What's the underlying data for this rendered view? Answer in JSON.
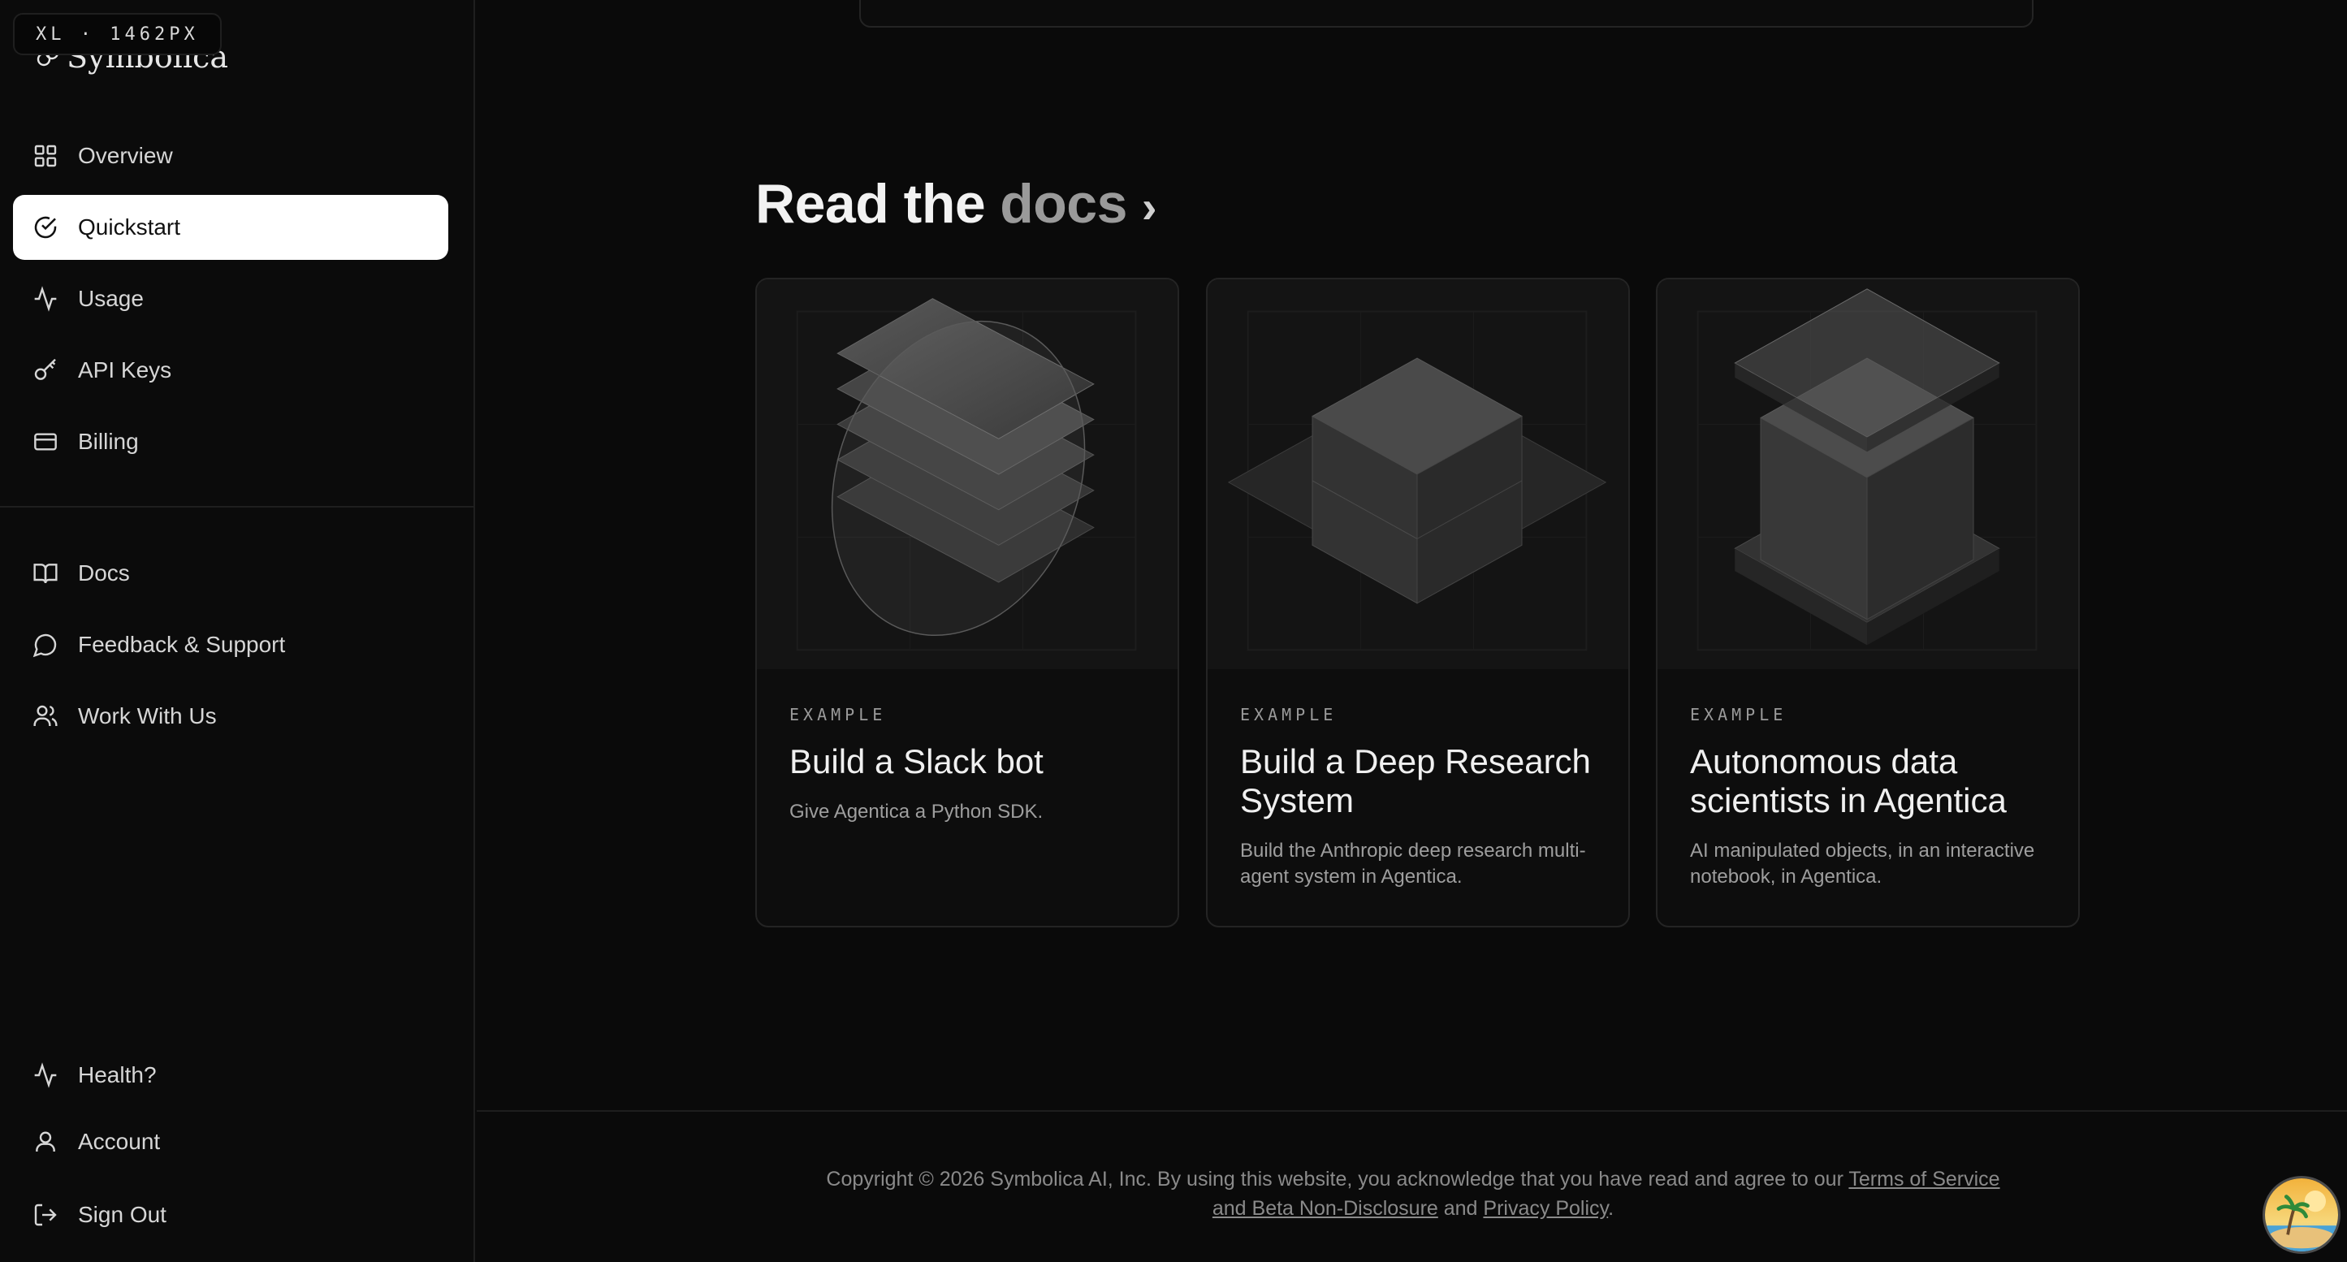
{
  "breakpoint_badge": "XL · 1462PX",
  "brand": {
    "name": "Symbolica"
  },
  "sidebar": {
    "primary": [
      {
        "label": "Overview",
        "icon": "grid-icon"
      },
      {
        "label": "Quickstart",
        "icon": "check-circle-icon",
        "active": true
      },
      {
        "label": "Usage",
        "icon": "activity-icon"
      },
      {
        "label": "API Keys",
        "icon": "key-icon"
      },
      {
        "label": "Billing",
        "icon": "credit-card-icon"
      }
    ],
    "secondary": [
      {
        "label": "Docs",
        "icon": "book-icon"
      },
      {
        "label": "Feedback & Support",
        "icon": "message-icon"
      },
      {
        "label": "Work With Us",
        "icon": "users-icon"
      }
    ],
    "bottom": [
      {
        "label": "Health?",
        "icon": "activity-icon"
      },
      {
        "label": "Account",
        "icon": "user-icon"
      },
      {
        "label": "Sign Out",
        "icon": "logout-icon"
      }
    ]
  },
  "main": {
    "section": {
      "title_prefix": "Read the",
      "title_accent": "docs",
      "chevron": "›"
    },
    "cards": [
      {
        "kicker": "EXAMPLE",
        "title": "Build a Slack bot",
        "description": "Give Agentica a Python SDK."
      },
      {
        "kicker": "EXAMPLE",
        "title": "Build a Deep Research System",
        "description": "Build the Anthropic deep research multi-agent system in Agentica."
      },
      {
        "kicker": "EXAMPLE",
        "title": "Autonomous data scientists in Agentica",
        "description": "AI manipulated objects, in an interactive notebook, in Agentica."
      }
    ]
  },
  "footer": {
    "text_before": "Copyright © 2026 Symbolica AI, Inc. By using this website, you acknowledge that you have read and agree to our",
    "terms_link": "Terms of Service and Beta Non-Disclosure",
    "and": "and",
    "privacy_link": "Privacy Policy",
    "end": "."
  },
  "colors": {
    "background": "#0a0a0a",
    "active_nav_bg": "#ffffff",
    "accent_text": "#9a9a9a"
  }
}
